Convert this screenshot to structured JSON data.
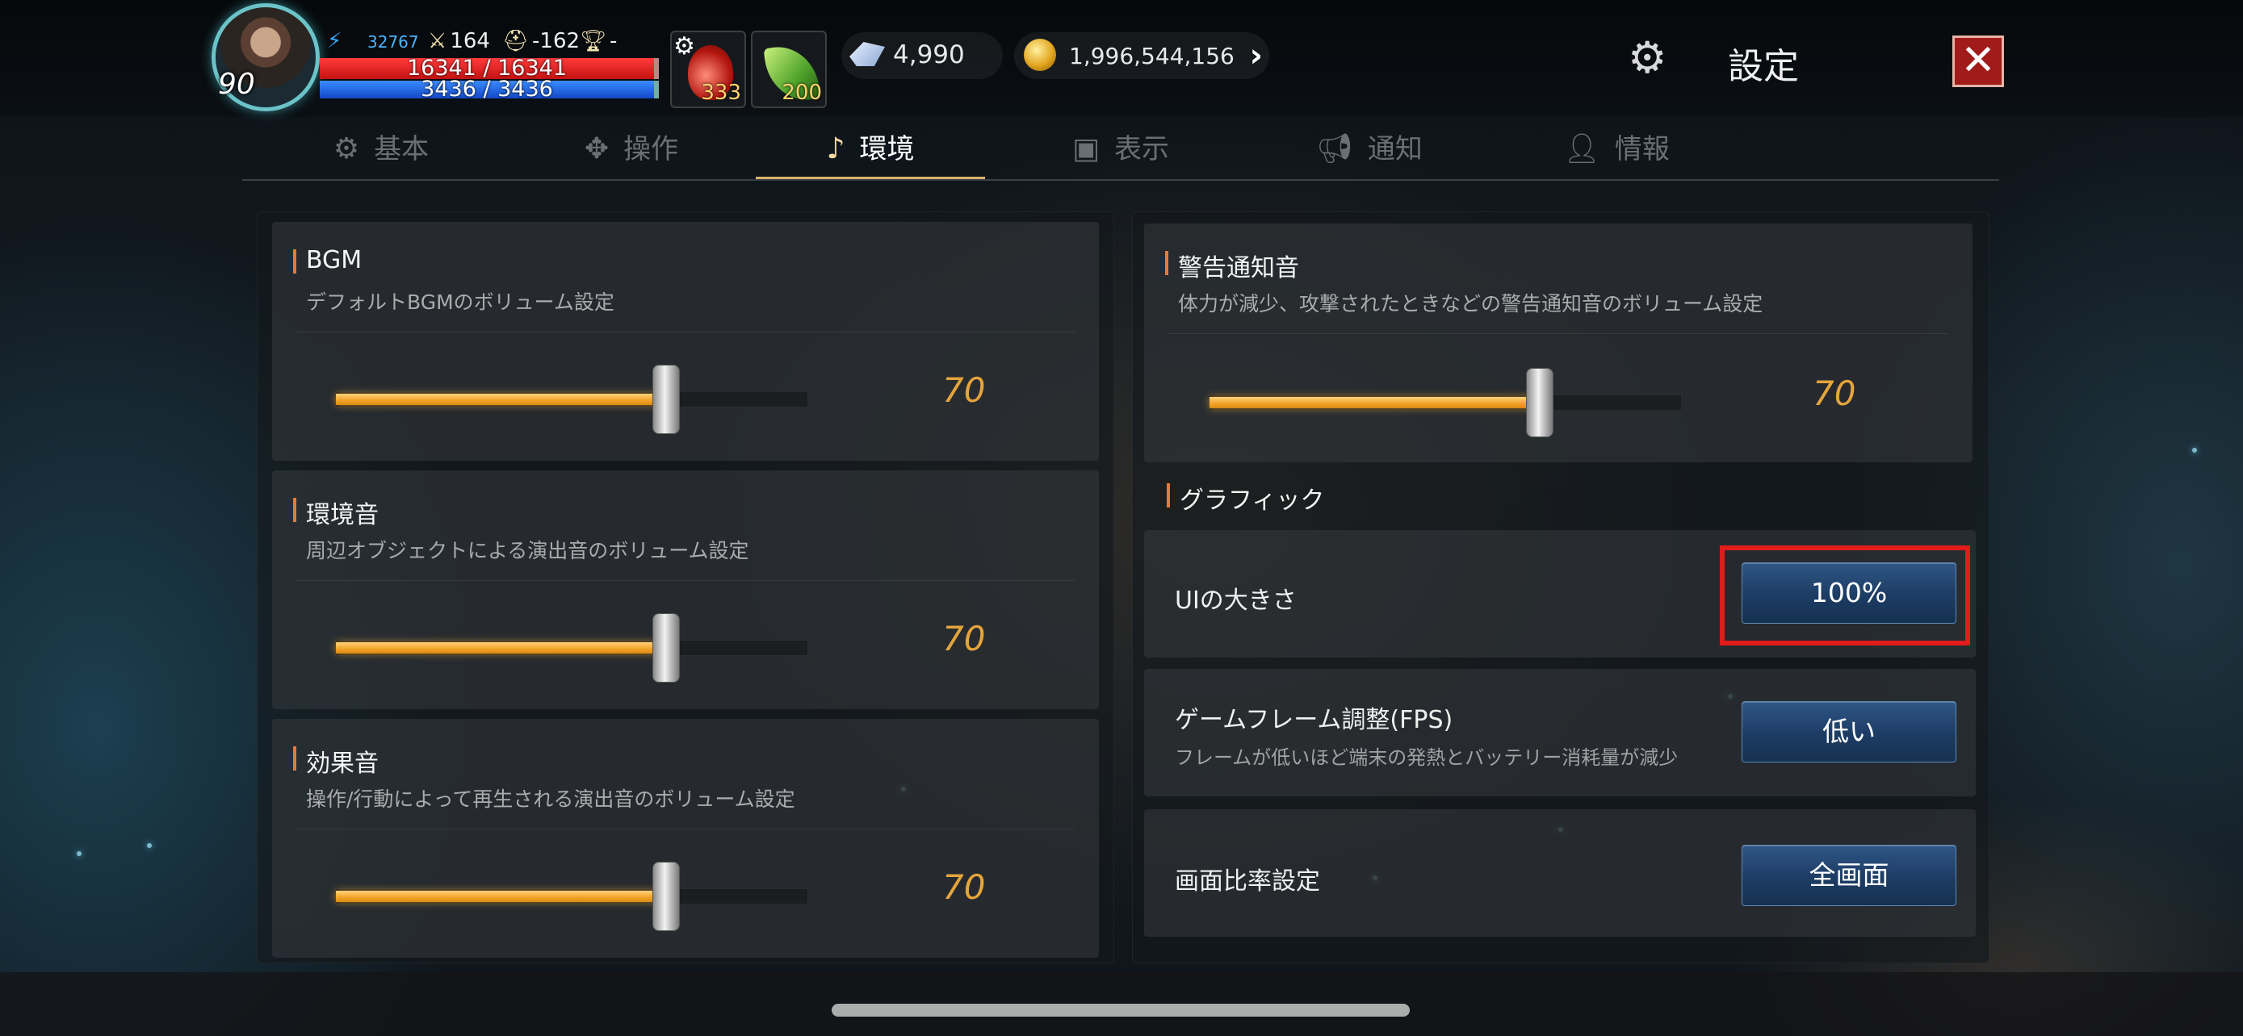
{
  "hud": {
    "level": "90",
    "power": "32767",
    "attack": "164",
    "defense": "-162",
    "rank": "-",
    "hp": "16341 / 16341",
    "mp": "3436 / 3436",
    "items": [
      {
        "name": "potion-icon",
        "count": "333"
      },
      {
        "name": "leaf-icon",
        "count": "200"
      }
    ],
    "crystals": "4,990",
    "gold": "1,996,544,156"
  },
  "header": {
    "title": "設定",
    "close_label": "✕"
  },
  "tabs": [
    {
      "label": "基本",
      "icon": "gear-icon",
      "active": false
    },
    {
      "label": "操作",
      "icon": "dpad-icon",
      "active": false
    },
    {
      "label": "環境",
      "icon": "music-note-icon",
      "active": true
    },
    {
      "label": "表示",
      "icon": "display-icon",
      "active": false
    },
    {
      "label": "通知",
      "icon": "megaphone-icon",
      "active": false
    },
    {
      "label": "情報",
      "icon": "person-info-icon",
      "active": false
    }
  ],
  "left": {
    "bgm": {
      "title": "BGM",
      "desc": "デフォルトBGMのボリューム設定",
      "value": "70",
      "percent": 70
    },
    "ambient": {
      "title": "環境音",
      "desc": "周辺オブジェクトによる演出音のボリューム設定",
      "value": "70",
      "percent": 70
    },
    "sfx": {
      "title": "効果音",
      "desc": "操作/行動によって再生される演出音のボリューム設定",
      "value": "70",
      "percent": 70
    }
  },
  "right": {
    "alert": {
      "title": "警告通知音",
      "desc": "体力が減少、攻撃されたときなどの警告通知音のボリューム設定",
      "value": "70",
      "percent": 70
    },
    "graphics_title": "グラフィック",
    "ui_size": {
      "label": "UIの大きさ",
      "value": "100%"
    },
    "fps": {
      "label": "ゲームフレーム調整(FPS)",
      "sub": "フレームが低いほど端末の発熱とバッテリー消耗量が減少",
      "value": "低い"
    },
    "aspect": {
      "label": "画面比率設定",
      "value": "全画面"
    }
  },
  "colors": {
    "accent": "#e5a53c",
    "active_tab_underline": "#d9b56a",
    "button_blue": "#1d3c64",
    "highlight_red": "#e21b1b"
  }
}
